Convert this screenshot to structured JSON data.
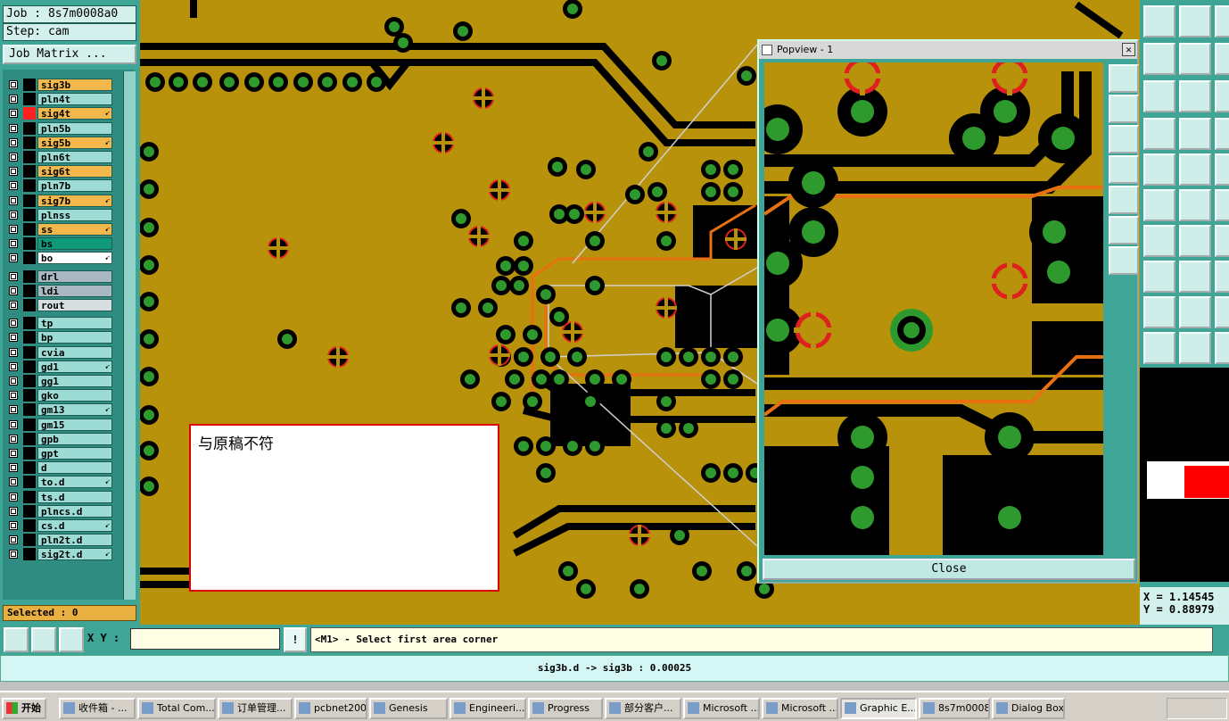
{
  "left_panel": {
    "job_label": "Job : 8s7m0008a0",
    "step_label": "Step: cam",
    "job_matrix_button": "Job Matrix ...",
    "layers": [
      {
        "name": "sig3b",
        "color": "#f2b84b",
        "swatch": "#000000",
        "mark": ""
      },
      {
        "name": "pln4t",
        "color": "#9ddcd4",
        "swatch": "#000000",
        "mark": ""
      },
      {
        "name": "sig4t",
        "color": "#f2b84b",
        "swatch": "#ff2020",
        "mark": "➹"
      },
      {
        "name": "pln5b",
        "color": "#9ddcd4",
        "swatch": "#000000",
        "mark": ""
      },
      {
        "name": "sig5b",
        "color": "#f2b84b",
        "swatch": "#000000",
        "mark": "➹"
      },
      {
        "name": "pln6t",
        "color": "#9ddcd4",
        "swatch": "#000000",
        "mark": ""
      },
      {
        "name": "sig6t",
        "color": "#f2b84b",
        "swatch": "#000000",
        "mark": ""
      },
      {
        "name": "pln7b",
        "color": "#9ddcd4",
        "swatch": "#000000",
        "mark": ""
      },
      {
        "name": "sig7b",
        "color": "#f2b84b",
        "swatch": "#000000",
        "mark": "➹"
      },
      {
        "name": "plnss",
        "color": "#9ddcd4",
        "swatch": "#000000",
        "mark": ""
      },
      {
        "name": "ss",
        "color": "#f2b84b",
        "swatch": "#000000",
        "mark": "➹"
      },
      {
        "name": "bs",
        "color": "#0f9a7a",
        "swatch": "#000000",
        "mark": ""
      },
      {
        "name": "bo",
        "color": "#ffffff",
        "swatch": "#000000",
        "mark": "➹"
      },
      {
        "name": "drl",
        "color": "#a9b8c0",
        "swatch": "#000000",
        "mark": ""
      },
      {
        "name": "ldi",
        "color": "#a9b8c0",
        "swatch": "#000000",
        "mark": ""
      },
      {
        "name": "rout",
        "color": "#d6dee0",
        "swatch": "#000000",
        "mark": ""
      },
      {
        "name": "tp",
        "color": "#9ddcd4",
        "swatch": "#000000",
        "mark": ""
      },
      {
        "name": "bp",
        "color": "#9ddcd4",
        "swatch": "#000000",
        "mark": ""
      },
      {
        "name": "cvia",
        "color": "#9ddcd4",
        "swatch": "#000000",
        "mark": ""
      },
      {
        "name": "gd1",
        "color": "#9ddcd4",
        "swatch": "#000000",
        "mark": "➹"
      },
      {
        "name": "gg1",
        "color": "#9ddcd4",
        "swatch": "#000000",
        "mark": ""
      },
      {
        "name": "gko",
        "color": "#9ddcd4",
        "swatch": "#000000",
        "mark": ""
      },
      {
        "name": "gm13",
        "color": "#9ddcd4",
        "swatch": "#000000",
        "mark": "➹"
      },
      {
        "name": "gm15",
        "color": "#9ddcd4",
        "swatch": "#000000",
        "mark": ""
      },
      {
        "name": "gpb",
        "color": "#9ddcd4",
        "swatch": "#000000",
        "mark": ""
      },
      {
        "name": "gpt",
        "color": "#9ddcd4",
        "swatch": "#000000",
        "mark": ""
      },
      {
        "name": "d",
        "color": "#9ddcd4",
        "swatch": "#000000",
        "mark": ""
      },
      {
        "name": "to.d",
        "color": "#9ddcd4",
        "swatch": "#000000",
        "mark": "➹"
      },
      {
        "name": "ts.d",
        "color": "#9ddcd4",
        "swatch": "#000000",
        "mark": ""
      },
      {
        "name": "plncs.d",
        "color": "#9ddcd4",
        "swatch": "#000000",
        "mark": ""
      },
      {
        "name": "cs.d",
        "color": "#9ddcd4",
        "swatch": "#000000",
        "mark": "➹"
      },
      {
        "name": "pln2t.d",
        "color": "#9ddcd4",
        "swatch": "#000000",
        "mark": ""
      },
      {
        "name": "sig2t.d",
        "color": "#9ddcd4",
        "swatch": "#000000",
        "mark": "➹"
      }
    ],
    "selected": "Selected : 0"
  },
  "note_box": {
    "text": "与原稿不符"
  },
  "popview": {
    "title": "Popview - 1",
    "close_button": "Close"
  },
  "coords": {
    "x": "X = 1.14545",
    "y": "Y = 0.88979"
  },
  "command_bar": {
    "xy_label": "X Y :",
    "xy_value": "",
    "message": "<M1> - Select first area corner"
  },
  "status": {
    "text": "sig3b.d -> sig3b : 0.00025"
  },
  "taskbar": {
    "start": "开始",
    "items": [
      {
        "label": "收件箱 - ...",
        "active": false
      },
      {
        "label": "Total Com...",
        "active": false
      },
      {
        "label": "订单管理...",
        "active": false
      },
      {
        "label": "pcbnet2002",
        "active": false
      },
      {
        "label": "Genesis",
        "active": false
      },
      {
        "label": "Engineeri...",
        "active": false
      },
      {
        "label": "Progress",
        "active": false
      },
      {
        "label": "部分客户...",
        "active": false
      },
      {
        "label": "Microsoft ...",
        "active": false
      },
      {
        "label": "Microsoft ...",
        "active": false
      },
      {
        "label": "Graphic E...",
        "active": true
      },
      {
        "label": "8s7m0008...",
        "active": false
      },
      {
        "label": "Dialog Box",
        "active": false
      }
    ]
  }
}
